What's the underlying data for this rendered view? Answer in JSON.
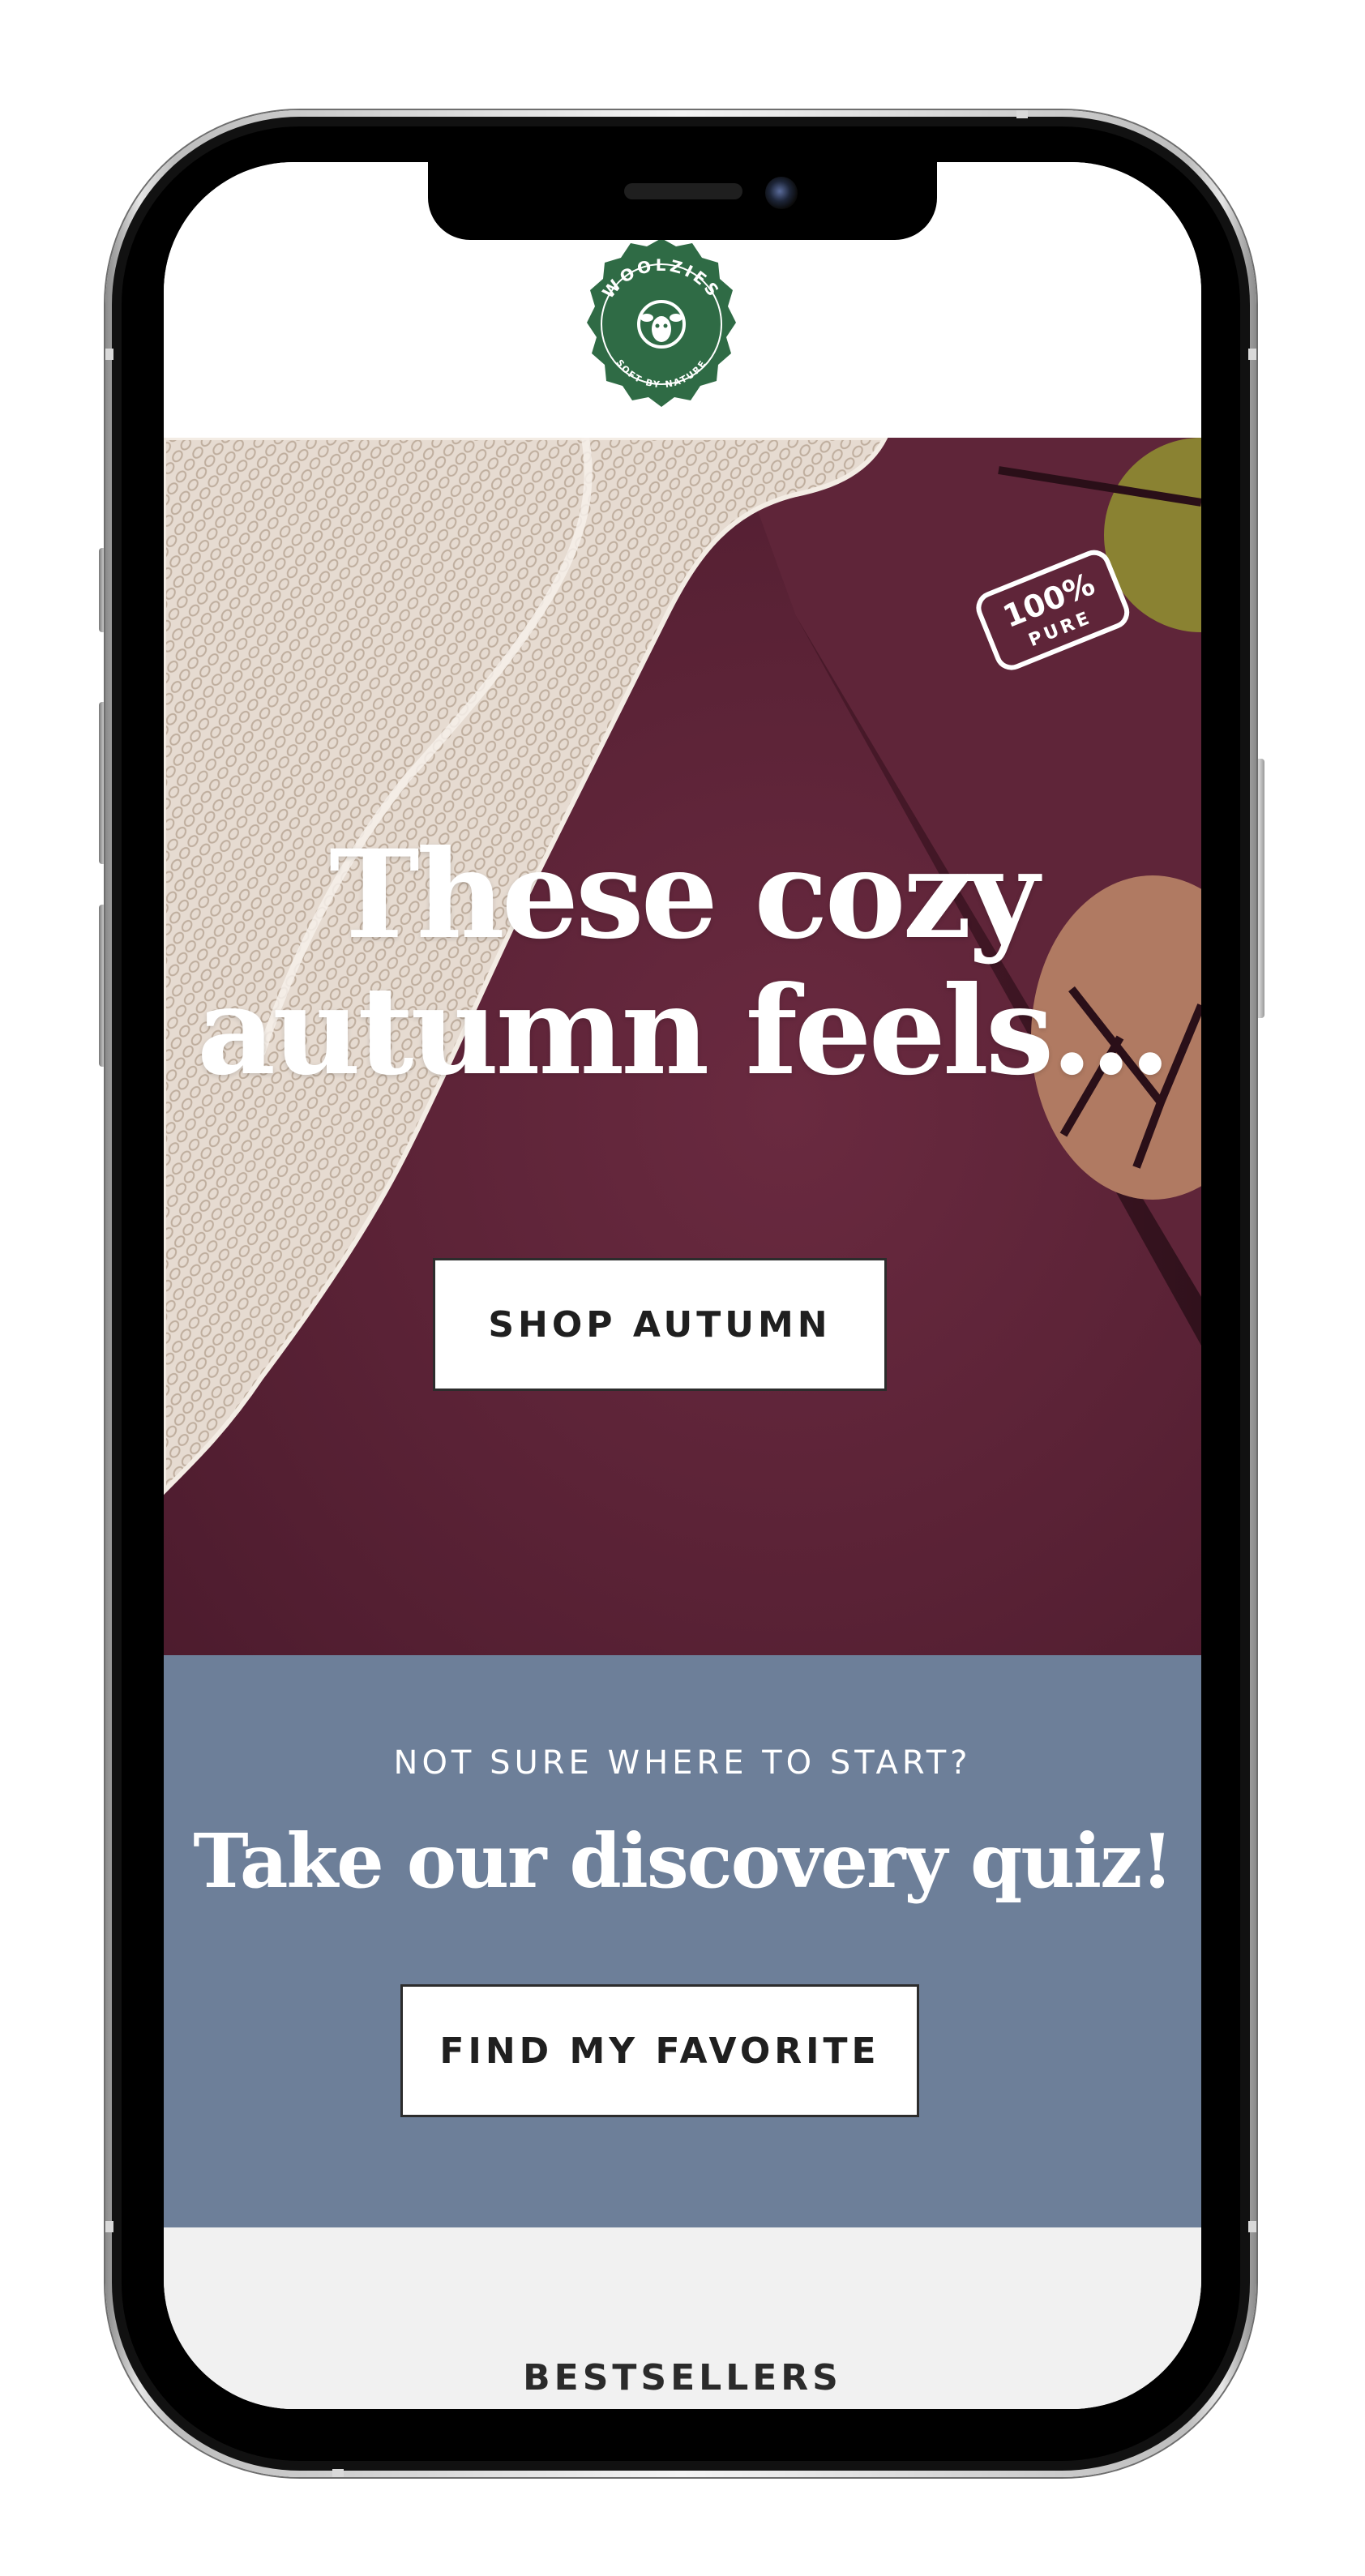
{
  "brand": {
    "logo_text": "WOOLZIES",
    "logo_tagline": "SOFT BY NATURE",
    "logo_color": "#2f6b45"
  },
  "hero": {
    "title_line1": "These cozy",
    "title_line2": "autumn feels...",
    "cta_label": "SHOP AUTUMN",
    "background_color": "#5c2337",
    "badge_text": "100% PURE"
  },
  "quiz": {
    "eyebrow": "NOT SURE WHERE TO START?",
    "title": "Take our discovery quiz!",
    "cta_label": "FIND MY FAVORITE",
    "background_color": "#6d7f99"
  },
  "bestsellers": {
    "title": "BESTSELLERS"
  }
}
